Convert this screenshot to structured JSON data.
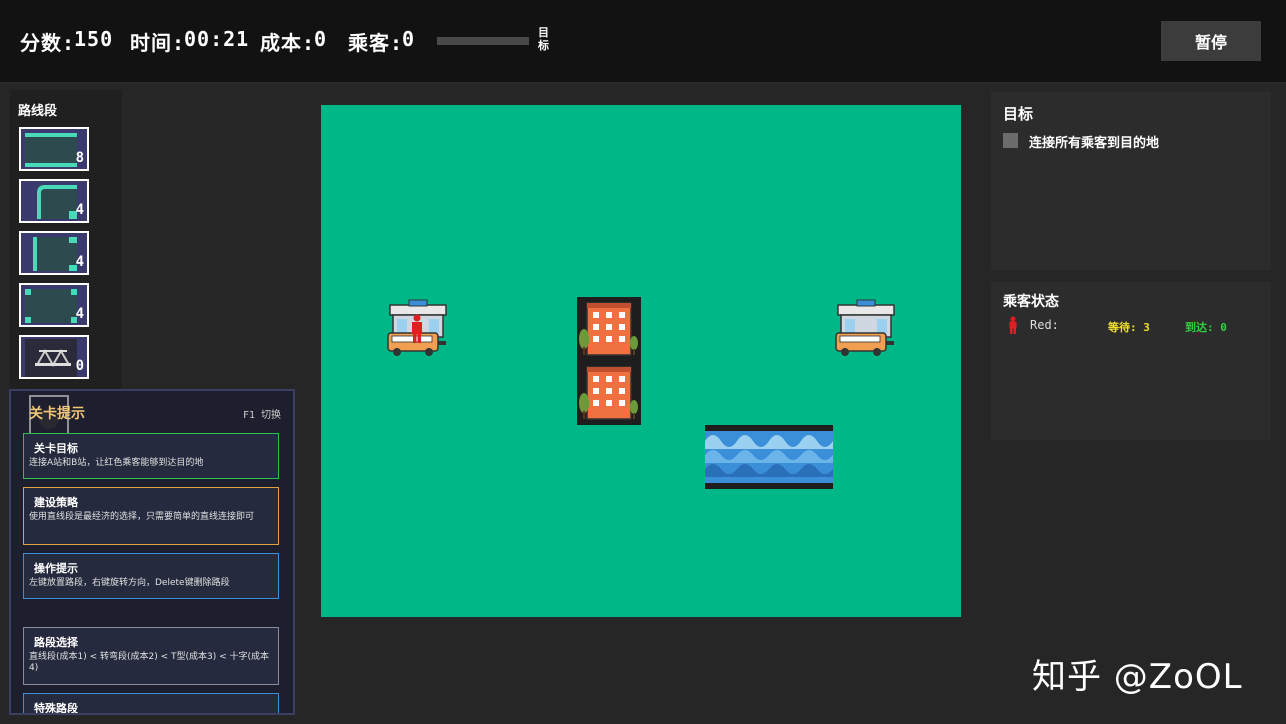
{
  "hud": {
    "score_label": "分数:",
    "score": "150",
    "time_label": "时间:",
    "time": "00:21",
    "cost_label": "成本:",
    "cost": "0",
    "passenger_label": "乘客:",
    "passengers": "0",
    "goal_progress_fraction": 0,
    "goal_label": "目标",
    "pause_label": "暂停"
  },
  "road_panel": {
    "title": "路线段",
    "items": [
      {
        "type": "straight",
        "count": "8"
      },
      {
        "type": "curve",
        "count": "4"
      },
      {
        "type": "t-junction",
        "count": "4"
      },
      {
        "type": "cross",
        "count": "4"
      },
      {
        "type": "bridge",
        "count": "0"
      }
    ]
  },
  "objectives": {
    "title": "目标",
    "items": [
      "连接所有乘客到目的地"
    ]
  },
  "passenger_status": {
    "title": "乘客状态",
    "rows": [
      {
        "color": "#e02020",
        "name": "Red:",
        "waiting": "等待: 3",
        "arrived": "到达: 0"
      }
    ]
  },
  "hints": {
    "title": "关卡提示",
    "toggle": "F1 切换",
    "cards": [
      {
        "title": "关卡目标",
        "body": "连接A站和B站，让红色乘客能够到达目的地",
        "border": "#2fbf4f"
      },
      {
        "title": "建设策略",
        "body": "使用直线段是最经济的选择，只需要简单的直线连接即可",
        "border": "#e0a040"
      },
      {
        "title": "操作提示",
        "body": "左键放置路段，右键旋转方向，Delete键删除路段",
        "border": "#3a8fd8"
      },
      {
        "title": "路段选择",
        "body": "直线段(成本1) < 转弯段(成本2) < T型(成本3) < 十字(成本4)",
        "border": "#8a8a9a"
      },
      {
        "title": "特殊路段",
        "body": "",
        "border": "#3a8fd8"
      }
    ]
  },
  "watermark": "知乎 @ZoOL",
  "colors": {
    "board": "#00b887",
    "road_slot": "#3b3a6e",
    "road_edge": "#49d9b8",
    "waiting": "#f0e030",
    "arrived": "#30d040"
  }
}
